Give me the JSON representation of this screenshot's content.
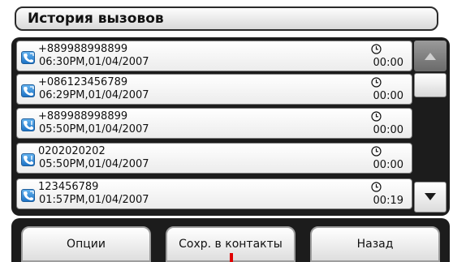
{
  "window": {
    "title": "История вызовов"
  },
  "calls": [
    {
      "number": "+889988998899",
      "datetime": "06:30PM,01/04/2007",
      "duration": "00:00",
      "type_icon": "phone-outgoing-icon"
    },
    {
      "number": "+086123456789",
      "datetime": "06:29PM,01/04/2007",
      "duration": "00:00",
      "type_icon": "phone-outgoing-icon"
    },
    {
      "number": "+889988998899",
      "datetime": "05:50PM,01/04/2007",
      "duration": "00:00",
      "type_icon": "phone-missed-icon"
    },
    {
      "number": "0202020202",
      "datetime": "05:50PM,01/04/2007",
      "duration": "00:00",
      "type_icon": "phone-missed-icon"
    },
    {
      "number": "123456789",
      "datetime": "01:57PM,01/04/2007",
      "duration": "00:19",
      "type_icon": "phone-outgoing-icon"
    }
  ],
  "buttons": {
    "options": "Опции",
    "save_to_contacts": "Сохр. в контакты",
    "back": "Назад"
  },
  "colors": {
    "panel": "#1c1c1c",
    "phone_icon": "#1e73c5",
    "marker": "#e00000"
  }
}
